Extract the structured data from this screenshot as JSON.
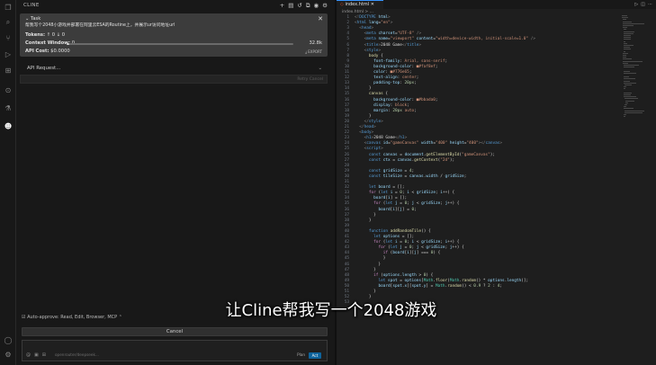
{
  "activity_bar": {
    "icons": [
      "files-icon",
      "search-icon",
      "source-control-icon",
      "run-debug-icon",
      "extensions-icon",
      "remote-icon",
      "test-icon",
      "cline-icon"
    ],
    "bottom_icons": [
      "account-icon",
      "gear-icon"
    ]
  },
  "sidebar": {
    "header": "CLINE",
    "header_icons": [
      "plus-icon",
      "server-icon",
      "history-icon",
      "popout-icon",
      "account-icon",
      "gear-icon"
    ],
    "task": {
      "label": "Task",
      "description": "帮我写个2048小游戏并部署在阿里云ESA的Routine上，并展示ur访问地址url",
      "tokens_label": "Tokens:",
      "tokens_value": "↑ 0  ↓ 0",
      "context_label": "Context Window:",
      "context_left": "0",
      "context_right": "32.8k",
      "context_used_fraction": 0.01,
      "api_cost_label": "API Cost:",
      "api_cost_value": "$0.0000",
      "export_label": "⤓ EXPORT"
    },
    "api_request": "API Request...",
    "api_box_left": "",
    "api_box_right": "Retry  Cancel",
    "auto_approve": "Auto-approve: Read, Edit, Browser, MCP",
    "cancel_button": "Cancel",
    "chat": {
      "tools": [
        "@",
        "▣",
        "⊞"
      ],
      "model": "openrouter/deepseek...",
      "plan_label": "Plan",
      "act_label": "Act"
    }
  },
  "editor": {
    "tab_label": "index.html",
    "breadcrumb": "index.html > ...",
    "lines": [
      {
        "n": "1",
        "html": "<span class='g'>&lt;!</span><span class='k'>DOCTYPE</span> <span class='a'>html</span><span class='g'>&gt;</span>"
      },
      {
        "n": "2",
        "html": "<span class='g'>&lt;</span><span class='k'>html</span> <span class='a'>lang</span>=<span class='s'>\"en\"</span><span class='g'>&gt;</span>"
      },
      {
        "n": "3",
        "html": "  <span class='g'>&lt;</span><span class='k'>head</span><span class='g'>&gt;</span>"
      },
      {
        "n": "4",
        "html": "    <span class='g'>&lt;</span><span class='k'>meta</span> <span class='a'>charset</span>=<span class='s'>\"UTF-8\"</span> <span class='g'>/&gt;</span>"
      },
      {
        "n": "5",
        "html": "    <span class='g'>&lt;</span><span class='k'>meta</span> <span class='a'>name</span>=<span class='s'>\"viewport\"</span> <span class='a'>content</span>=<span class='s'>\"width=device-width, initial-scale=1.0\"</span> <span class='g'>/&gt;</span>"
      },
      {
        "n": "6",
        "html": "    <span class='g'>&lt;</span><span class='k'>title</span><span class='g'>&gt;</span>2048 Game<span class='g'>&lt;/</span><span class='k'>title</span><span class='g'>&gt;</span>"
      },
      {
        "n": "7",
        "html": "    <span class='g'>&lt;</span><span class='k'>style</span><span class='g'>&gt;</span>"
      },
      {
        "n": "8",
        "html": "      <span class='f'>body</span> {"
      },
      {
        "n": "9",
        "html": "        <span class='v'>font-family</span>: <span class='s'>Arial, sans-serif</span>;"
      },
      {
        "n": "10",
        "html": "        <span class='v'>background-color</span>: <span class='s'>■#faf8ef</span>;"
      },
      {
        "n": "11",
        "html": "        <span class='v'>color</span>: <span class='s'>■#776e65</span>;"
      },
      {
        "n": "12",
        "html": "        <span class='v'>text-align</span>: <span class='s'>center</span>;"
      },
      {
        "n": "13",
        "html": "        <span class='v'>padding-top</span>: <span class='num'>20px</span>;"
      },
      {
        "n": "14",
        "html": "      }"
      },
      {
        "n": "15",
        "html": "      <span class='f'>canvas</span> {"
      },
      {
        "n": "16",
        "html": "        <span class='v'>background-color</span>: <span class='s'>■#bbada0</span>;"
      },
      {
        "n": "17",
        "html": "        <span class='v'>display</span>: <span class='s'>block</span>;"
      },
      {
        "n": "18",
        "html": "        <span class='v'>margin</span>: <span class='num'>20px</span> <span class='s'>auto</span>;"
      },
      {
        "n": "19",
        "html": "      }"
      },
      {
        "n": "20",
        "html": "    <span class='g'>&lt;/</span><span class='k'>style</span><span class='g'>&gt;</span>"
      },
      {
        "n": "21",
        "html": "  <span class='g'>&lt;/</span><span class='k'>head</span><span class='g'>&gt;</span>"
      },
      {
        "n": "22",
        "html": "  <span class='g'>&lt;</span><span class='k'>body</span><span class='g'>&gt;</span>"
      },
      {
        "n": "23",
        "html": "    <span class='g'>&lt;</span><span class='k'>h1</span><span class='g'>&gt;</span>2048 Game<span class='g'>&lt;/</span><span class='k'>h1</span><span class='g'>&gt;</span>"
      },
      {
        "n": "24",
        "html": "    <span class='g'>&lt;</span><span class='k'>canvas</span> <span class='a'>id</span>=<span class='s'>\"gameCanvas\"</span> <span class='a'>width</span>=<span class='s'>\"400\"</span> <span class='a'>height</span>=<span class='s'>\"400\"</span><span class='g'>&gt;&lt;/</span><span class='k'>canvas</span><span class='g'>&gt;</span>"
      },
      {
        "n": "25",
        "html": "    <span class='g'>&lt;</span><span class='k'>script</span><span class='g'>&gt;</span>"
      },
      {
        "n": "26",
        "html": "      <span class='k'>const</span> <span class='v'>canvas</span> = <span class='v'>document</span>.<span class='f'>getElementById</span>(<span class='s'>\"gameCanvas\"</span>);"
      },
      {
        "n": "27",
        "html": "      <span class='k'>const</span> <span class='v'>ctx</span> = <span class='v'>canvas</span>.<span class='f'>getContext</span>(<span class='s'>\"2d\"</span>);"
      },
      {
        "n": "28",
        "html": ""
      },
      {
        "n": "29",
        "html": "      <span class='k'>const</span> <span class='v'>gridSize</span> = <span class='num'>4</span>;"
      },
      {
        "n": "30",
        "html": "      <span class='k'>const</span> <span class='v'>tileSize</span> = <span class='v'>canvas</span>.<span class='v'>width</span> / <span class='v'>gridSize</span>;"
      },
      {
        "n": "31",
        "html": ""
      },
      {
        "n": "32",
        "html": "      <span class='k'>let</span> <span class='v'>board</span> = [];"
      },
      {
        "n": "33",
        "html": "      <span class='p'>for</span> (<span class='k'>let</span> <span class='v'>i</span> = <span class='num'>0</span>; <span class='v'>i</span> &lt; <span class='v'>gridSize</span>; <span class='v'>i</span>++) {"
      },
      {
        "n": "34",
        "html": "        <span class='v'>board</span>[<span class='v'>i</span>] = [];"
      },
      {
        "n": "35",
        "html": "        <span class='p'>for</span> (<span class='k'>let</span> <span class='v'>j</span> = <span class='num'>0</span>; <span class='v'>j</span> &lt; <span class='v'>gridSize</span>; <span class='v'>j</span>++) {"
      },
      {
        "n": "36",
        "html": "          <span class='v'>board</span>[<span class='v'>i</span>][<span class='v'>j</span>] = <span class='num'>0</span>;"
      },
      {
        "n": "37",
        "html": "        }"
      },
      {
        "n": "38",
        "html": "      }"
      },
      {
        "n": "39",
        "html": ""
      },
      {
        "n": "40",
        "html": "      <span class='k'>function</span> <span class='f'>addRandomTile</span>() {"
      },
      {
        "n": "41",
        "html": "        <span class='k'>let</span> <span class='v'>options</span> = [];"
      },
      {
        "n": "42",
        "html": "        <span class='p'>for</span> (<span class='k'>let</span> <span class='v'>i</span> = <span class='num'>0</span>; <span class='v'>i</span> &lt; <span class='v'>gridSize</span>; <span class='v'>i</span>++) {"
      },
      {
        "n": "43",
        "html": "          <span class='p'>for</span> (<span class='k'>let</span> <span class='v'>j</span> = <span class='num'>0</span>; <span class='v'>j</span> &lt; <span class='v'>gridSize</span>; <span class='v'>j</span>++) {"
      },
      {
        "n": "44",
        "html": "            <span class='p'>if</span> (<span class='v'>board</span>[<span class='v'>i</span>][<span class='v'>j</span>] === <span class='num'>0</span>) {"
      },
      {
        "n": "45",
        "html": "            }"
      },
      {
        "n": "46",
        "html": "          }"
      },
      {
        "n": "47",
        "html": "        }"
      },
      {
        "n": "48",
        "html": "        <span class='p'>if</span> (<span class='v'>options</span>.<span class='v'>length</span> &gt; <span class='num'>0</span>) {"
      },
      {
        "n": "49",
        "html": "          <span class='k'>let</span> <span class='v'>spot</span> = <span class='v'>options</span>[<span class='t'>Math</span>.<span class='f'>floor</span>(<span class='t'>Math</span>.<span class='f'>random</span>() * <span class='v'>options</span>.<span class='v'>length</span>)];"
      },
      {
        "n": "50",
        "html": "          <span class='v'>board</span>[<span class='v'>spot</span>.<span class='v'>x</span>][<span class='v'>spot</span>.<span class='v'>y</span>] = <span class='t'>Math</span>.<span class='f'>random</span>() &lt; <span class='num'>0.9</span> ? <span class='num'>2</span> : <span class='num'>4</span>;"
      },
      {
        "n": "51",
        "html": "        }"
      },
      {
        "n": "52",
        "html": "      }"
      },
      {
        "n": "53",
        "html": ""
      }
    ]
  },
  "caption": "让Cline帮我写一个2048游戏"
}
